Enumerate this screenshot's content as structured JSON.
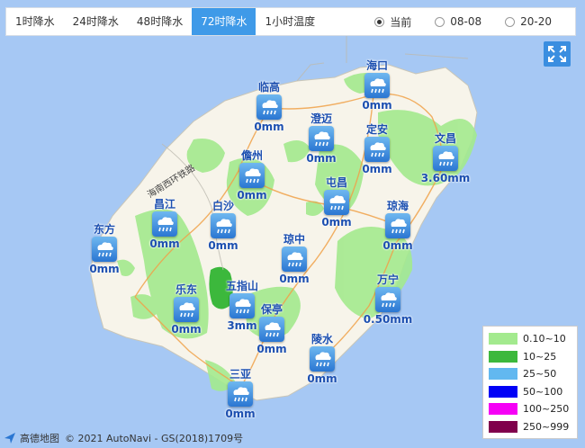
{
  "tabs": [
    {
      "label": "1时降水",
      "active": false
    },
    {
      "label": "24时降水",
      "active": false
    },
    {
      "label": "48时降水",
      "active": false
    },
    {
      "label": "72时降水",
      "active": true
    },
    {
      "label": "1小时温度",
      "active": false
    }
  ],
  "time_options": [
    {
      "label": "当前",
      "selected": true
    },
    {
      "label": "08-08",
      "selected": false
    },
    {
      "label": "20-20",
      "selected": false
    }
  ],
  "road_label": "海南西环铁路",
  "stations": [
    {
      "name": "海口",
      "value": "0mm"
    },
    {
      "name": "临高",
      "value": "0mm"
    },
    {
      "name": "澄迈",
      "value": "0mm"
    },
    {
      "name": "定安",
      "value": "0mm"
    },
    {
      "name": "文昌",
      "value": "3.60mm"
    },
    {
      "name": "儋州",
      "value": "0mm"
    },
    {
      "name": "屯昌",
      "value": "0mm"
    },
    {
      "name": "昌江",
      "value": "0mm"
    },
    {
      "name": "白沙",
      "value": "0mm"
    },
    {
      "name": "琼海",
      "value": "0mm"
    },
    {
      "name": "东方",
      "value": "0mm"
    },
    {
      "name": "琼中",
      "value": "0mm"
    },
    {
      "name": "万宁",
      "value": "0.50mm"
    },
    {
      "name": "乐东",
      "value": "0mm"
    },
    {
      "name": "五指山",
      "value": "3mm"
    },
    {
      "name": "保亭",
      "value": "0mm"
    },
    {
      "name": "陵水",
      "value": "0mm"
    },
    {
      "name": "三亚",
      "value": "0mm"
    }
  ],
  "legend": [
    {
      "label": "0.10~10",
      "color": "#a3ea8e"
    },
    {
      "label": "10~25",
      "color": "#3cb83c"
    },
    {
      "label": "25~50",
      "color": "#62b8f0"
    },
    {
      "label": "50~100",
      "color": "#0000f6"
    },
    {
      "label": "100~250",
      "color": "#f600f6"
    },
    {
      "label": "250~999",
      "color": "#80004c"
    }
  ],
  "footer": {
    "brand": "高德地图",
    "copyright": "© 2021 AutoNavi - GS(2018)1709号"
  },
  "icons": {
    "weather": "rain-cloud-icon",
    "fullscreen": "expand-icon",
    "logo": "amap-logo-icon"
  }
}
